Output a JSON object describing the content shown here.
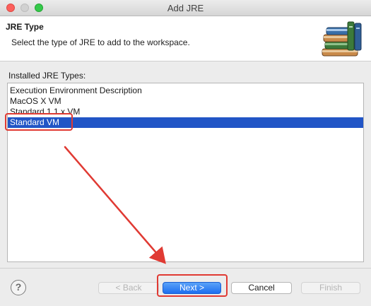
{
  "window": {
    "title": "Add JRE"
  },
  "header": {
    "title": "JRE Type",
    "description": "Select the type of JRE to add to the workspace.",
    "icon": "books-icon"
  },
  "list": {
    "label": "Installed JRE Types:",
    "items": [
      {
        "label": "Execution Environment Description",
        "selected": false
      },
      {
        "label": "MacOS X VM",
        "selected": false
      },
      {
        "label": "Standard 1.1.x VM",
        "selected": false
      },
      {
        "label": "Standard VM",
        "selected": true
      }
    ]
  },
  "buttons": {
    "help_label": "?",
    "back_label": "< Back",
    "next_label": "Next >",
    "cancel_label": "Cancel",
    "finish_label": "Finish"
  },
  "colors": {
    "selection": "#2155c6",
    "annotation": "#e03a33",
    "default_button": "#1d6ef0"
  }
}
